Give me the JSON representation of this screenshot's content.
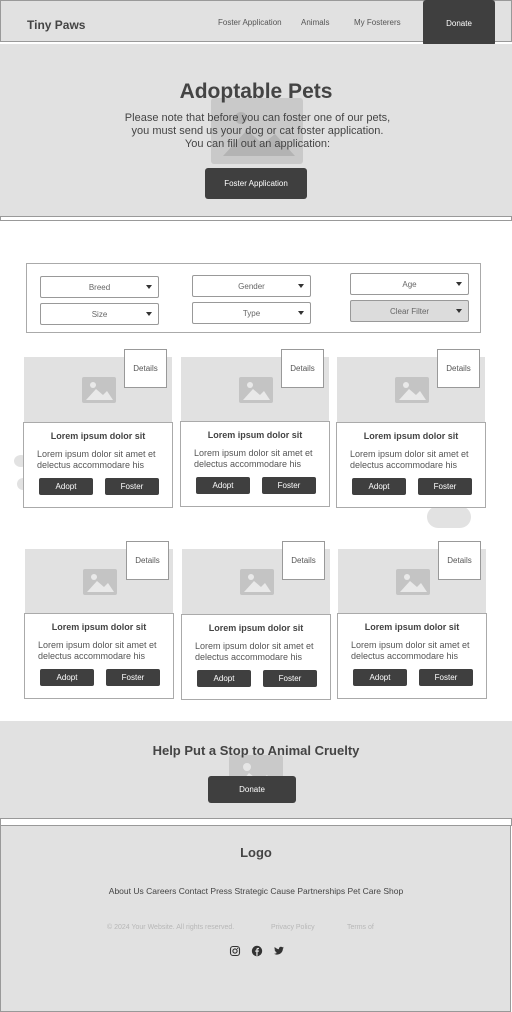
{
  "nav": {
    "brand": "Tiny Paws",
    "links": [
      "Foster Application",
      "Animals",
      "My Fosterers"
    ],
    "donate": "Donate"
  },
  "hero": {
    "title": "Adoptable Pets",
    "lines": [
      "Please note that before you can foster one of our pets,",
      "you must send us your dog or cat foster application.",
      "You can fill out an application:"
    ],
    "button": "Foster Application"
  },
  "filters": {
    "breed": "Breed",
    "gender": "Gender",
    "age": "Age",
    "size": "Size",
    "type": "Type",
    "clear": "Clear Filter"
  },
  "cards": [
    {
      "details": "Details",
      "title": "Lorem ipsum dolor sit",
      "desc": "Lorem ipsum dolor sit amet et delectus accommodare his",
      "adopt": "Adopt",
      "foster": "Foster"
    },
    {
      "details": "Details",
      "title": "Lorem ipsum dolor sit",
      "desc": "Lorem ipsum dolor sit amet et delectus accommodare his",
      "adopt": "Adopt",
      "foster": "Foster"
    },
    {
      "details": "Details",
      "title": "Lorem ipsum dolor sit",
      "desc": "Lorem ipsum dolor sit amet et delectus accommodare his",
      "adopt": "Adopt",
      "foster": "Foster"
    },
    {
      "details": "Details",
      "title": "Lorem ipsum dolor sit",
      "desc": "Lorem ipsum dolor sit amet et delectus accommodare his",
      "adopt": "Adopt",
      "foster": "Foster"
    },
    {
      "details": "Details",
      "title": "Lorem ipsum dolor sit",
      "desc": "Lorem ipsum dolor sit amet et delectus accommodare his",
      "adopt": "Adopt",
      "foster": "Foster"
    },
    {
      "details": "Details",
      "title": "Lorem ipsum dolor sit",
      "desc": "Lorem ipsum dolor sit amet et delectus accommodare his",
      "adopt": "Adopt",
      "foster": "Foster"
    }
  ],
  "cruelty": {
    "title": "Help Put a Stop to Animal Cruelty",
    "button": "Donate"
  },
  "footer": {
    "logo": "Logo",
    "links": [
      "About Us",
      "Careers",
      "Contact",
      "Press",
      "Strategic Cause Partnerships",
      "Pet Care Shop"
    ],
    "copyright": "© 2024 Your Website. All rights reserved.",
    "privacy": "Privacy Policy",
    "terms": "Terms of",
    "icons": [
      "instagram-icon",
      "facebook-icon",
      "twitter-icon"
    ]
  },
  "colors": {
    "panel": "#e1e1e1",
    "button": "#3f3f3f",
    "placeholder": "#c9c9c9"
  }
}
